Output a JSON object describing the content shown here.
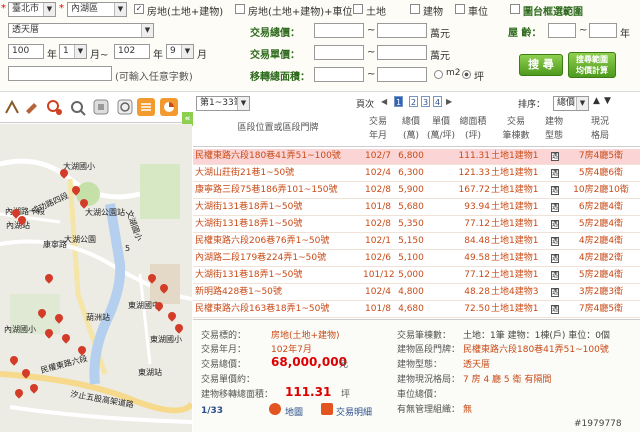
{
  "filter": {
    "city": "臺北市",
    "district": "內湖區",
    "types": [
      {
        "label": "房地(土地+建物)",
        "checked": true
      },
      {
        "label": "房地(土地+建物)+車位",
        "checked": false
      },
      {
        "label": "土地",
        "checked": false
      },
      {
        "label": "建物",
        "checked": false
      },
      {
        "label": "車位",
        "checked": false
      }
    ],
    "map_select_label": "圖台框選範圍",
    "project": "透天厝",
    "total_price_label": "交易總價：",
    "total_price_unit": "萬元",
    "unit_price_label": "交易單價：",
    "unit_price_unit": "萬元",
    "age_label": "屋 齡：",
    "age_unit": "年",
    "area_label": "移轉總面積：",
    "area_unit_m2": "m2",
    "area_unit_ping": "坪",
    "range_sep": "~",
    "date_from_year": "100",
    "date_from_month": "1",
    "date_to_year": "102",
    "date_to_month": "9",
    "year_label": "年",
    "month_to_label": "月~",
    "month_label": "月",
    "address_hint": "(可輸入任意字數)",
    "search_label": "搜 尋",
    "search_calc_label_1": "搜尋範圍",
    "search_calc_label_2": "均價計算"
  },
  "map": {
    "labels": [
      "大湖國小",
      "內湖站",
      "大湖公園站",
      "大湖公園",
      "成功路四段",
      "內湖路一段",
      "康寧路",
      "文湖國小",
      "葫洲站",
      "東湖站",
      "汐止五股高架道路",
      "內湖國小",
      "民權東路六段",
      "東湖國中",
      "東湖國小",
      "5"
    ]
  },
  "results": {
    "page_range": "第1~33筆",
    "page_label": "頁次",
    "pages": [
      "1",
      "2",
      "3",
      "4"
    ],
    "next": "▶",
    "sort_label": "排序：",
    "sort_value": "總價",
    "headers": {
      "address": "區段位置或區段門牌",
      "date_1": "交易",
      "date_2": "年月",
      "price_1": "總價",
      "price_2": "(萬)",
      "unit_1": "單價",
      "unit_2": "(萬/坪)",
      "area_1": "總面積",
      "area_2": "(坪)",
      "target_1": "交易",
      "target_2": "筆棟數",
      "type_1": "建物",
      "type_2": "型態",
      "layout_1": "現況",
      "layout_2": "格局"
    },
    "rows": [
      {
        "address": "民權東路六段180巷41弄51~100號",
        "date": "102/7",
        "price": "6,800",
        "area": "111.31",
        "target": "土地1建物1",
        "type": "透",
        "layout": "7房4廳5衛"
      },
      {
        "address": "大湖山莊街21巷1~50號",
        "date": "102/4",
        "price": "6,300",
        "area": "121.33",
        "target": "土地1建物1",
        "type": "透",
        "layout": "5房4廳6衛"
      },
      {
        "address": "康寧路三段75巷186弄101~150號",
        "date": "102/8",
        "price": "5,900",
        "area": "167.72",
        "target": "土地1建物1",
        "type": "透",
        "layout": "10房2廳10衛"
      },
      {
        "address": "大湖街131巷18弄1~50號",
        "date": "101/8",
        "price": "5,680",
        "area": "93.94",
        "target": "土地1建物1",
        "type": "透",
        "layout": "6房2廳4衛"
      },
      {
        "address": "大湖街131巷18弄1~50號",
        "date": "102/8",
        "price": "5,350",
        "area": "77.12",
        "target": "土地1建物1",
        "type": "透",
        "layout": "5房2廳4衛"
      },
      {
        "address": "民權東路六段206巷76弄1~50號",
        "date": "102/1",
        "price": "5,150",
        "area": "84.48",
        "target": "土地1建物1",
        "type": "透",
        "layout": "4房2廳4衛"
      },
      {
        "address": "內湖路二段179巷224弄1~50號",
        "date": "102/6",
        "price": "5,100",
        "area": "49.58",
        "target": "土地1建物1",
        "type": "透",
        "layout": "4房2廳2衛"
      },
      {
        "address": "大湖街131巷18弄1~50號",
        "date": "101/12",
        "price": "5,000",
        "area": "77.12",
        "target": "土地1建物1",
        "type": "透",
        "layout": "5房2廳4衛"
      },
      {
        "address": "新明路428巷1~50號",
        "date": "102/4",
        "price": "4,800",
        "area": "48.28",
        "target": "土地4建物3",
        "type": "透",
        "layout": "3房2廳3衛"
      },
      {
        "address": "民權東路六段163巷18弄1~50號",
        "date": "101/8",
        "price": "4,680",
        "area": "72.50",
        "target": "土地1建物1",
        "type": "透",
        "layout": "7房4廳5衛"
      }
    ]
  },
  "detail": {
    "usage_label": "交易標的：",
    "usage_value": "房地(土地+建物)",
    "date_label": "交易年月：",
    "date_value": "102年7月",
    "total_label": "交易總價：",
    "total_value": "68,000,000",
    "total_unit": "元",
    "unit_label": "交易單價約：",
    "area_label": "建物移轉總面積：",
    "area_value": "111.31",
    "area_unit": "坪",
    "count_label": "交易筆棟數：",
    "count_value": "土地：1筆 建物：1棟(戶) 車位：0個",
    "addr_label": "建物區段門牌：",
    "addr_value": "民權東路六段180巷41弄51~100號",
    "type_label": "建物型態：",
    "type_value": "透天厝",
    "layout_label": "建物現況格局：",
    "layout_value": "7 房 4 廳 5 衛 有隔間",
    "parking_label": "車位總價：",
    "mgmt_label": "有無管理組織：",
    "mgmt_value": "無",
    "page_indicator": "1/33",
    "map_btn": "地圖",
    "detail_btn": "交易明細"
  },
  "watermark": "#1979778"
}
